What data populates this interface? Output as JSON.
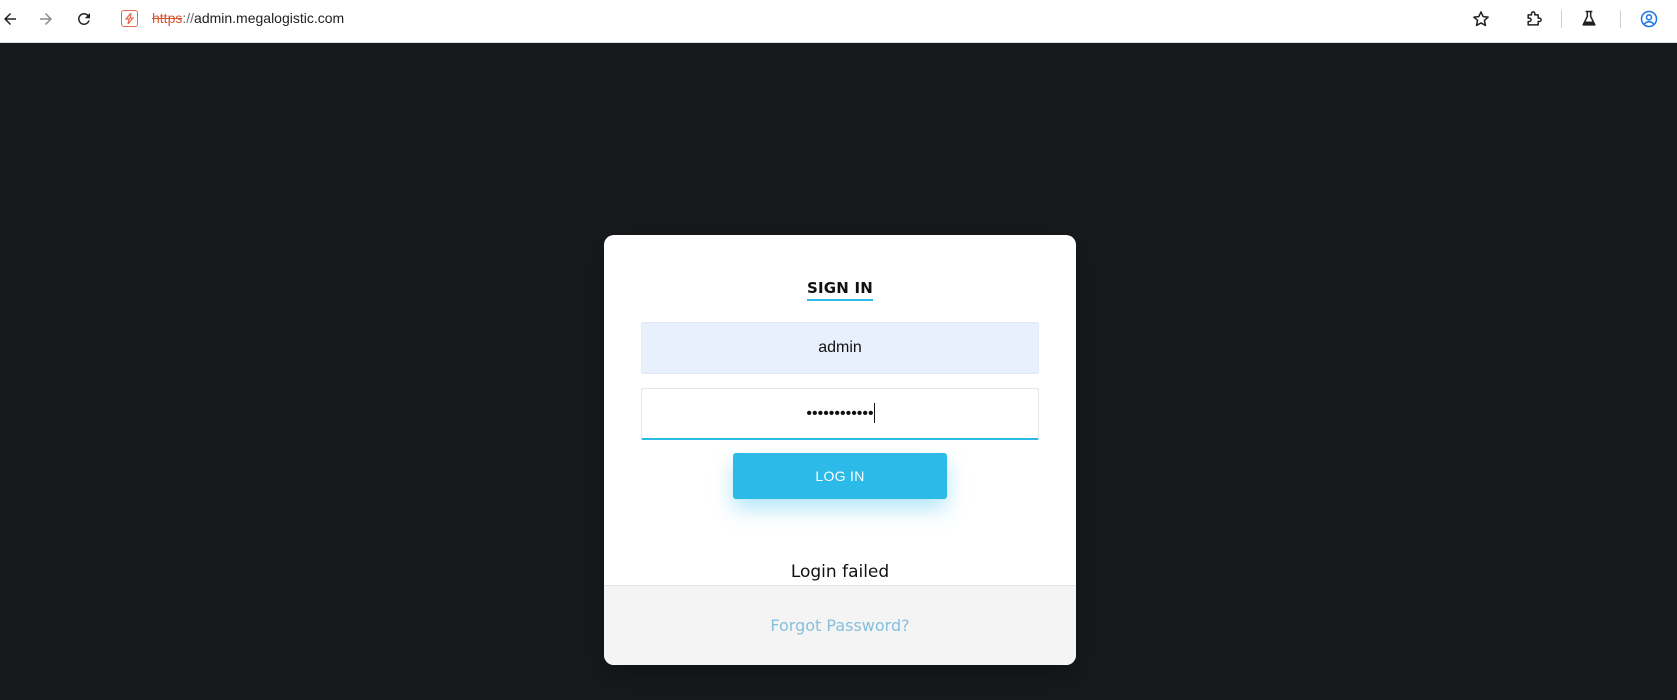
{
  "browser": {
    "url_scheme": "https",
    "url_sep": "://",
    "url_host": "admin.megalogistic.com"
  },
  "icons": {
    "back": "arrow-left-icon",
    "forward": "arrow-right-icon",
    "reload": "reload-icon",
    "site": "not-secure-icon",
    "bookmark": "star-icon",
    "extensions": "puzzle-icon",
    "labs": "flask-icon",
    "profile": "account-circle-icon"
  },
  "login": {
    "title": "SIGN IN",
    "username_value": "admin",
    "password_value": "••••••••••••",
    "button_label": "LOG IN",
    "error_message": "Login failed",
    "forgot_label": "Forgot Password?"
  },
  "colors": {
    "accent": "#2cbbe8",
    "background": "#171a1d",
    "link": "#86bfdc"
  }
}
